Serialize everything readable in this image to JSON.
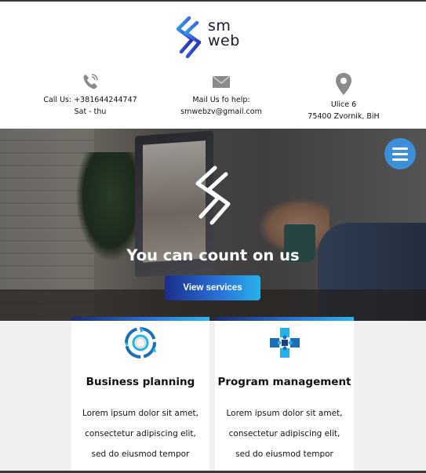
{
  "brand": {
    "logo_text_line1": "sm",
    "logo_text_line2": "web"
  },
  "contacts": [
    {
      "icon": "phone-icon",
      "line1": "Call Us: +381644244747",
      "line2": "Sat - thu"
    },
    {
      "icon": "mail-icon",
      "line1": "Mail Us fo help:",
      "line2": "smwebzv@gmail.com"
    },
    {
      "icon": "map-pin-icon",
      "line1": "Ulice 6",
      "line2": "75400 Zvornik, BiH"
    }
  ],
  "hero": {
    "title": "You can count on us",
    "cta_label": "View services"
  },
  "menu": {
    "icon": "hamburger-menu-icon"
  },
  "services": [
    {
      "icon": "cycle-target-icon",
      "title": "Business planning",
      "text": "Lorem ipsum dolor sit amet, consectetur adipiscing elit, sed do eiusmod tempor incididunt ut labore sed"
    },
    {
      "icon": "puzzle-cross-icon",
      "title": "Program management",
      "text": "Lorem ipsum dolor sit amet, consectetur adipiscing elit, sed do eiusmod tempor incididunt ut labore sed"
    }
  ],
  "colors": {
    "accent_dark": "#1a2b72",
    "accent": "#2a6fd6",
    "accent_light": "#2cb6ec",
    "menu_button": "#3c8fd8"
  }
}
